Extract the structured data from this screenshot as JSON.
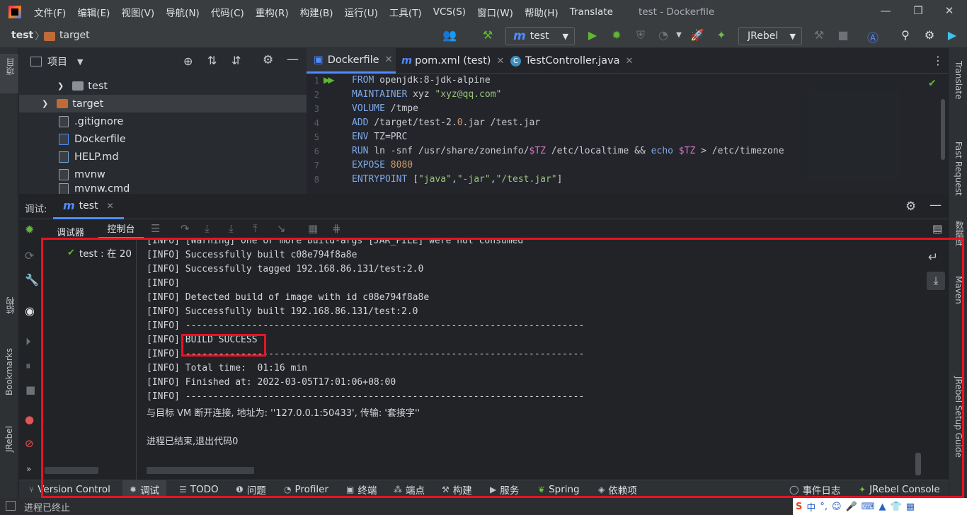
{
  "titlebar": {
    "menu": [
      "文件(F)",
      "编辑(E)",
      "视图(V)",
      "导航(N)",
      "代码(C)",
      "重构(R)",
      "构建(B)",
      "运行(U)",
      "工具(T)",
      "VCS(S)",
      "窗口(W)",
      "帮助(H)",
      "Translate"
    ],
    "window_title": "test - Dockerfile",
    "minimize": "—",
    "restore": "❐",
    "close": "✕"
  },
  "navbar": {
    "project": "test",
    "separator": "〉",
    "folder": "target",
    "run_config": "test",
    "run_config_icon": "m",
    "jrebel_select": "JRebel"
  },
  "project_panel": {
    "title": "项目",
    "items": [
      {
        "label": "test",
        "type": "folder"
      },
      {
        "label": "target",
        "type": "folder-orange"
      },
      {
        "label": ".gitignore",
        "type": "file"
      },
      {
        "label": "Dockerfile",
        "type": "file"
      },
      {
        "label": "HELP.md",
        "type": "file"
      },
      {
        "label": "mvnw",
        "type": "file"
      },
      {
        "label": "mvnw.cmd",
        "type": "file"
      }
    ]
  },
  "editor": {
    "tabs": [
      {
        "label": "Dockerfile",
        "icon": "docker-icon"
      },
      {
        "label": "pom.xml (test)",
        "icon": "maven-icon"
      },
      {
        "label": "TestController.java",
        "icon": "class-icon"
      }
    ],
    "line_numbers": [
      "1",
      "2",
      "3",
      "4",
      "5",
      "6",
      "7",
      "8"
    ],
    "lines": [
      {
        "kw": "FROM",
        "rest": " openjdk:8-jdk-alpine"
      },
      {
        "kw": "MAINTAINER",
        "rest": " xyz ",
        "str": "\"xyz@qq.com\""
      },
      {
        "kw": "VOLUME",
        "rest": " /tmpe"
      },
      {
        "kw": "ADD",
        "rest": " /target/test-2.",
        "num": "0",
        "rest2": ".jar /test.jar"
      },
      {
        "kw": "ENV",
        "rest": " TZ=PRC"
      },
      {
        "kw": "RUN",
        "rest": " ln -snf /usr/share/zoneinfo/",
        "var": "$TZ",
        "rest2": " /etc/localtime && ",
        "kw2": "echo",
        "var2": " $TZ",
        "rest3": " > /etc/timezone"
      },
      {
        "kw": "EXPOSE",
        "num": " 8080"
      },
      {
        "kw": "ENTRYPOINT",
        "rest": " [",
        "str": "\"java\"",
        "rest2": ",",
        "str2": "\"-jar\"",
        "rest3": ",",
        "str3": "\"/test.jar\"",
        "rest4": "]"
      }
    ]
  },
  "debug": {
    "label": "调试:",
    "session_tab": "test",
    "subtabs": [
      "调试器",
      "控制台"
    ],
    "tree_item": "test : 在 20",
    "console_lines": [
      "[INFO] [Warning] One or more build-args [JAR_FILE] were not consumed",
      "[INFO] Successfully built c08e794f8a8e",
      "[INFO] Successfully tagged 192.168.86.131/test:2.0",
      "[INFO]",
      "[INFO] Detected build of image with id c08e794f8a8e",
      "[INFO] Successfully built 192.168.86.131/test:2.0",
      "[INFO] ------------------------------------------------------------------------",
      "[INFO] BUILD SUCCESS",
      "[INFO] ------------------------------------------------------------------------",
      "[INFO] Total time:  01:16 min",
      "[INFO] Finished at: 2022-03-05T17:01:06+08:00",
      "[INFO] ------------------------------------------------------------------------",
      "与目标 VM 断开连接, 地址为: ''127.0.0.1:50433', 传输: '套接字''",
      "",
      "进程已结束,退出代码0"
    ]
  },
  "left_stripe": {
    "project": "项目",
    "structure": "结构",
    "bookmarks": "Bookmarks",
    "jrebel": "JRebel"
  },
  "right_stripe": {
    "translate": "Translate",
    "fast_request": "Fast Request",
    "database": "数据库",
    "maven": "Maven",
    "jrebel_guide": "JRebel Setup Guide"
  },
  "bottom_tabs": [
    {
      "label": "Version Control",
      "icon": "branch-icon"
    },
    {
      "label": "调试",
      "icon": "bug-icon"
    },
    {
      "label": "TODO",
      "icon": "list-icon"
    },
    {
      "label": "问题",
      "icon": "info-icon"
    },
    {
      "label": "Profiler",
      "icon": "profiler-icon"
    },
    {
      "label": "终端",
      "icon": "terminal-icon"
    },
    {
      "label": "端点",
      "icon": "endpoints-icon"
    },
    {
      "label": "构建",
      "icon": "hammer-icon"
    },
    {
      "label": "服务",
      "icon": "services-icon"
    },
    {
      "label": "Spring",
      "icon": "spring-icon"
    },
    {
      "label": "依赖项",
      "icon": "stack-icon"
    },
    {
      "label": "事件日志",
      "icon": "search-icon"
    },
    {
      "label": "JRebel Console",
      "icon": "jrebel-icon"
    }
  ],
  "statusbar": {
    "text": "进程已终止",
    "ime": "中"
  },
  "colors": {
    "accent_blue": "#4f8cff",
    "run_green": "#5fb832",
    "annotation_red": "#e81224",
    "folder_orange": "#c06b37"
  }
}
